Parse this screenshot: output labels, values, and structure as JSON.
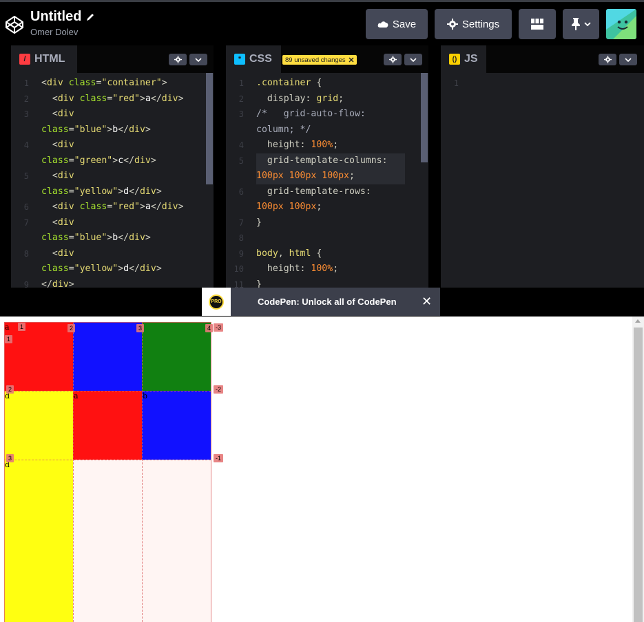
{
  "header": {
    "title": "Untitled",
    "author": "Omer Dolev",
    "save_label": "Save",
    "settings_label": "Settings"
  },
  "editors": {
    "html": {
      "label": "HTML",
      "line_numbers": [
        "1",
        "2",
        "3",
        "",
        "4",
        "",
        "5",
        "",
        "6",
        "7",
        "",
        "8",
        "",
        "9"
      ],
      "lines": [
        [
          "<div class=\"container\">"
        ],
        [
          "  <div class=\"red\">a</div>"
        ],
        [
          "  <div"
        ],
        [
          "class=\"blue\">b</div>"
        ],
        [
          "  <div"
        ],
        [
          "class=\"green\">c</div>"
        ],
        [
          "  <div"
        ],
        [
          "class=\"yellow\">d</div>"
        ],
        [
          "  <div class=\"red\">a</div>"
        ],
        [
          "  <div"
        ],
        [
          "class=\"blue\">b</div>"
        ],
        [
          "  <div"
        ],
        [
          "class=\"yellow\">d</div>"
        ],
        [
          "</div>"
        ]
      ]
    },
    "css": {
      "label": "CSS",
      "badge": "89 unsaved changes",
      "line_numbers": [
        "1",
        "2",
        "3",
        "",
        "4",
        "5",
        "",
        "6",
        "",
        "7",
        "8",
        "9",
        "10",
        "11"
      ]
    },
    "js": {
      "label": "JS",
      "line_numbers": [
        "1"
      ]
    }
  },
  "banner": {
    "text": "CodePen: Unlock all of CodePen",
    "pro_label": "PRO"
  },
  "grid_preview": {
    "cells": [
      {
        "color": "#ff1111",
        "label": "a"
      },
      {
        "color": "#1111ff",
        "label": "b"
      },
      {
        "color": "#118011",
        "label": "c"
      },
      {
        "color": "#ffff11",
        "label": "d"
      },
      {
        "color": "#ff1111",
        "label": "a"
      },
      {
        "color": "#1111ff",
        "label": "b"
      },
      {
        "color": "#ffff11",
        "label": "d"
      }
    ],
    "column_line_labels": [
      "1",
      "2",
      "3",
      "4"
    ],
    "row_line_labels": [
      "1",
      "2",
      "3"
    ],
    "negative_row_labels": [
      "-3",
      "-2",
      "-1"
    ]
  }
}
